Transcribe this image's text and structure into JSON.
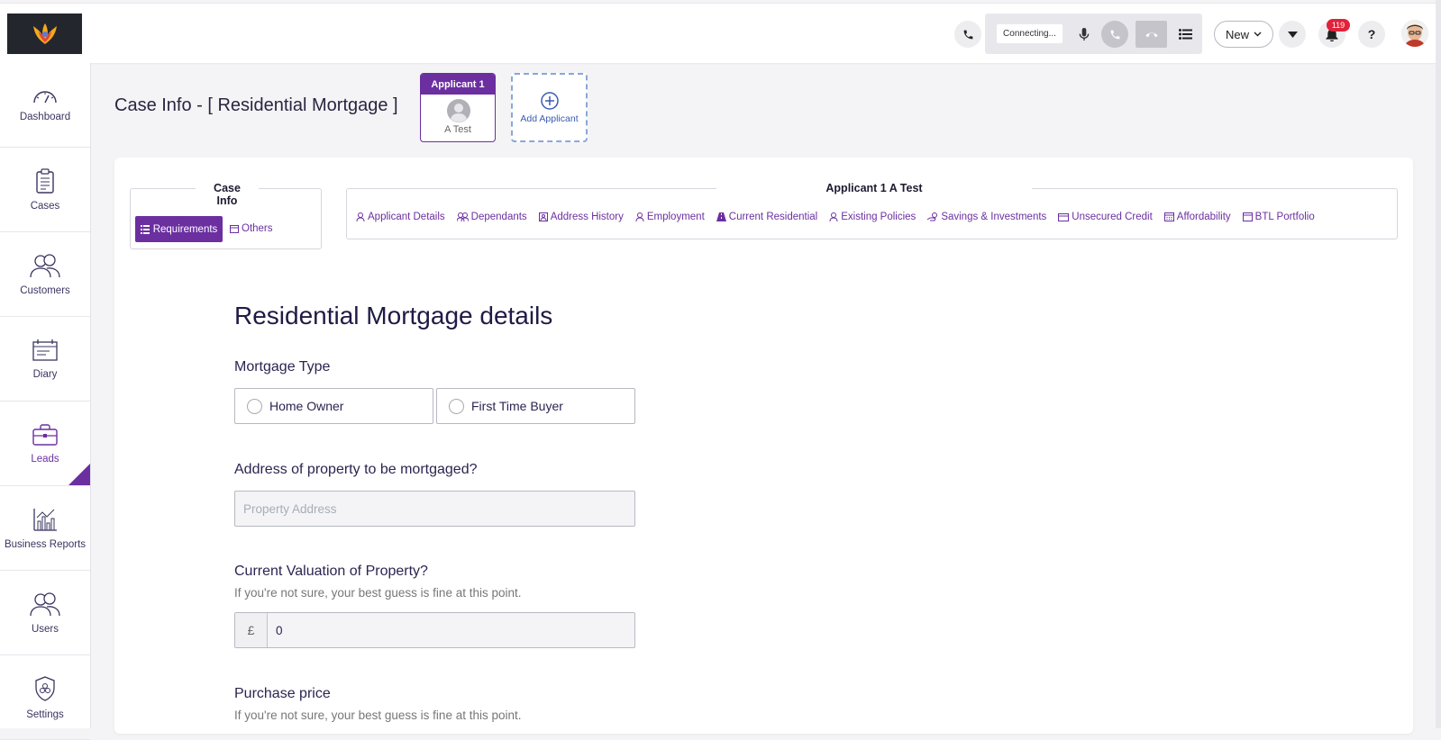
{
  "topbar": {
    "connecting_text": "Connecting...",
    "new_button_label": "New",
    "notification_count": "119"
  },
  "sidebar": {
    "items": [
      {
        "label": "Dashboard",
        "icon": "dashboard-icon"
      },
      {
        "label": "Cases",
        "icon": "clipboard-icon"
      },
      {
        "label": "Customers",
        "icon": "people-icon"
      },
      {
        "label": "Diary",
        "icon": "diary-icon"
      },
      {
        "label": "Leads",
        "icon": "briefcase-icon"
      },
      {
        "label": "Business Reports",
        "icon": "bar-chart-icon"
      },
      {
        "label": "Users",
        "icon": "users-icon"
      },
      {
        "label": "Settings",
        "icon": "shield-gear-icon"
      }
    ],
    "active": "Leads"
  },
  "header": {
    "title": "Case Info - [ Residential Mortgage ]",
    "applicant_card": {
      "head": "Applicant 1",
      "name": "A Test"
    },
    "add_applicant_label": "Add Applicant"
  },
  "case_info": {
    "legend_line1": "Case",
    "legend_line2": "Info",
    "requirements_label": "Requirements",
    "others_label": "Others"
  },
  "applicant_section": {
    "legend": "Applicant 1 A Test",
    "tabs": [
      "Applicant Details",
      "Dependants",
      "Address History",
      "Employment",
      "Current Residential",
      "Existing Policies",
      "Savings & Investments",
      "Unsecured Credit",
      "Affordability",
      "BTL Portfolio"
    ]
  },
  "form": {
    "title": "Residential Mortgage details",
    "mortgage_type_label": "Mortgage Type",
    "options": [
      "Home Owner",
      "First Time Buyer"
    ],
    "address_label": "Address of property to be mortgaged?",
    "address_placeholder": "Property Address",
    "valuation_label": "Current Valuation of Property?",
    "valuation_hint": "If you're not sure, your best guess is fine at this point.",
    "currency_symbol": "£",
    "valuation_value": "0",
    "purchase_label": "Purchase price",
    "purchase_hint": "If you're not sure, your best guess is fine at this point."
  },
  "colors": {
    "accent": "#6b2fa0",
    "text": "#2a2550",
    "badge": "#e0233a"
  }
}
